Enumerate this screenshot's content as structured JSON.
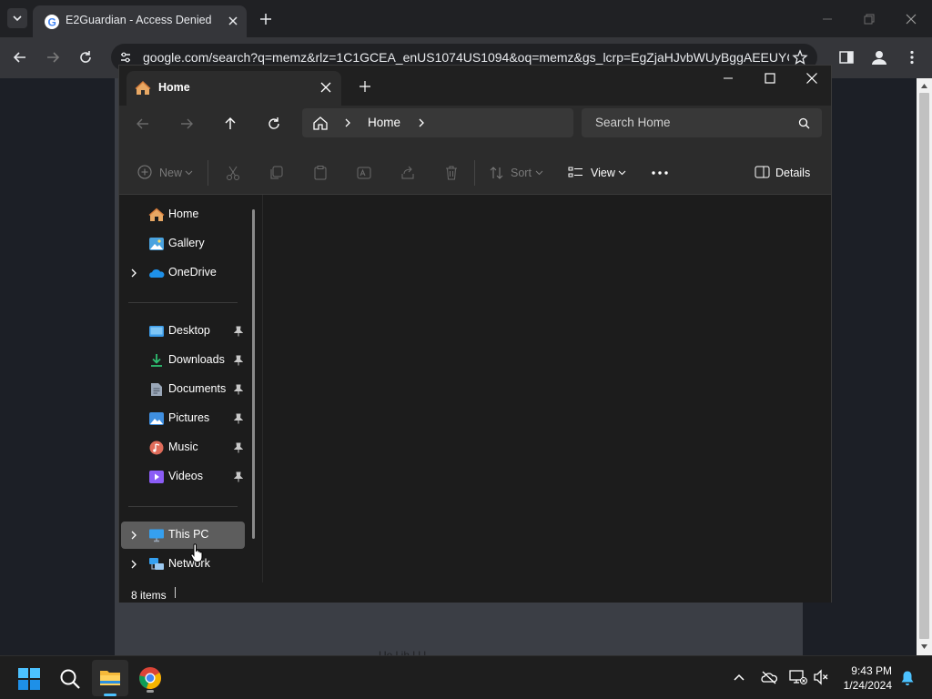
{
  "chrome": {
    "tab_title": "E2Guardian - Access Denied",
    "url": "google.com/search?q=memz&rlz=1C1GCEA_enUS1074US1094&oq=memz&gs_lcrp=EgZjaHJvbWUyBggAEEUYO..."
  },
  "page": {
    "partial_text": "Ue  l   ih          l  l  l"
  },
  "explorer": {
    "tab_label": "Home",
    "breadcrumb_home": "Home",
    "search_placeholder": "Search Home",
    "toolbar": {
      "new_label": "New",
      "sort_label": "Sort",
      "view_label": "View",
      "details_label": "Details"
    },
    "nav": {
      "home": "Home",
      "gallery": "Gallery",
      "onedrive": "OneDrive",
      "desktop": "Desktop",
      "downloads": "Downloads",
      "documents": "Documents",
      "pictures": "Pictures",
      "music": "Music",
      "videos": "Videos",
      "this_pc": "This PC",
      "network": "Network"
    },
    "status": "8 items"
  },
  "taskbar": {
    "time": "9:43 PM",
    "date": "1/24/2024"
  },
  "colors": {
    "accent": "#4cc2ff",
    "explorer_bg": "#1c1c1c",
    "chrome_toolbar": "#35363a"
  }
}
